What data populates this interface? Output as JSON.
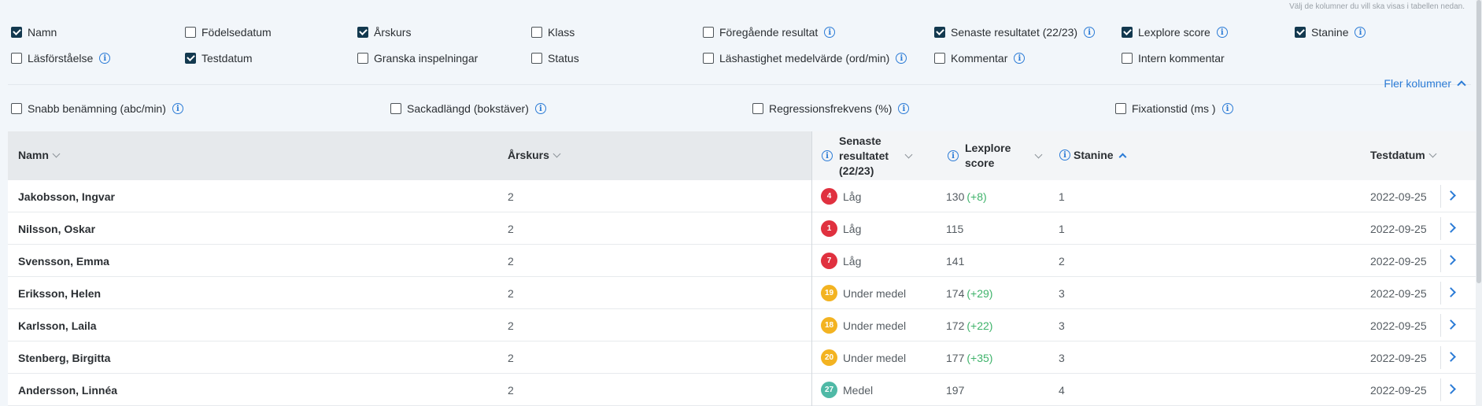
{
  "hint": "Välj de kolumner du vill ska visas i tabellen nedan.",
  "columns": {
    "row1": [
      {
        "label": "Namn",
        "checked": true,
        "info": false
      },
      {
        "label": "Födelsedatum",
        "checked": false,
        "info": false
      },
      {
        "label": "Årskurs",
        "checked": true,
        "info": false
      },
      {
        "label": "Klass",
        "checked": false,
        "info": false
      },
      {
        "label": "Föregående resultat",
        "checked": false,
        "info": true
      },
      {
        "label": "Senaste resultatet (22/23)",
        "checked": true,
        "info": true
      },
      {
        "label": "Lexplore score",
        "checked": true,
        "info": true
      },
      {
        "label": "Stanine",
        "checked": true,
        "info": true
      }
    ],
    "row2": [
      {
        "label": "Läsförståelse",
        "checked": false,
        "info": true
      },
      {
        "label": "Testdatum",
        "checked": true,
        "info": false
      },
      {
        "label": "Granska inspelningar",
        "checked": false,
        "info": false
      },
      {
        "label": "Status",
        "checked": false,
        "info": false
      },
      {
        "label": "Läshastighet medelvärde (ord/min)",
        "checked": false,
        "info": true
      },
      {
        "label": "Kommentar",
        "checked": false,
        "info": true
      },
      {
        "label": "Intern kommentar",
        "checked": false,
        "info": false
      }
    ],
    "row3": [
      {
        "label": "Snabb benämning (abc/min)",
        "checked": false,
        "info": true
      },
      {
        "label": "Sackadlängd (bokstäver)",
        "checked": false,
        "info": true
      },
      {
        "label": "Regressionsfrekvens (%)",
        "checked": false,
        "info": true
      },
      {
        "label": "Fixationstid (ms )",
        "checked": false,
        "info": true
      }
    ]
  },
  "more_columns_label": "Fler kolumner",
  "table": {
    "headers": {
      "name": "Namn",
      "grade": "Årskurs",
      "result_line1": "Senaste",
      "result_line2": "resultatet",
      "result_line3": "(22/23)",
      "score_line1": "Lexplore",
      "score_line2": "score",
      "stanine": "Stanine",
      "date": "Testdatum"
    },
    "rows": [
      {
        "name": "Jakobsson, Ingvar",
        "grade": "2",
        "badge": "4",
        "badge_color": "#e0313f",
        "result": "Låg",
        "score": "130",
        "delta": "(+8)",
        "stanine": "1",
        "date": "2022-09-25"
      },
      {
        "name": "Nilsson, Oskar",
        "grade": "2",
        "badge": "1",
        "badge_color": "#e0313f",
        "result": "Låg",
        "score": "115",
        "delta": "",
        "stanine": "1",
        "date": "2022-09-25"
      },
      {
        "name": "Svensson, Emma",
        "grade": "2",
        "badge": "7",
        "badge_color": "#e0313f",
        "result": "Låg",
        "score": "141",
        "delta": "",
        "stanine": "2",
        "date": "2022-09-25"
      },
      {
        "name": "Eriksson, Helen",
        "grade": "2",
        "badge": "19",
        "badge_color": "#f3b321",
        "result": "Under medel",
        "score": "174",
        "delta": "(+29)",
        "stanine": "3",
        "date": "2022-09-25"
      },
      {
        "name": "Karlsson, Laila",
        "grade": "2",
        "badge": "18",
        "badge_color": "#f3b321",
        "result": "Under medel",
        "score": "172",
        "delta": "(+22)",
        "stanine": "3",
        "date": "2022-09-25"
      },
      {
        "name": "Stenberg, Birgitta",
        "grade": "2",
        "badge": "20",
        "badge_color": "#f3b321",
        "result": "Under medel",
        "score": "177",
        "delta": "(+35)",
        "stanine": "3",
        "date": "2022-09-25"
      },
      {
        "name": "Andersson, Linnéa",
        "grade": "2",
        "badge": "27",
        "badge_color": "#4fb9a6",
        "result": "Medel",
        "score": "197",
        "delta": "",
        "stanine": "4",
        "date": "2022-09-25"
      }
    ]
  },
  "colors": {
    "accent": "#2b7bd6",
    "checkbox_on": "#13394f",
    "positive": "#3fb36b"
  }
}
